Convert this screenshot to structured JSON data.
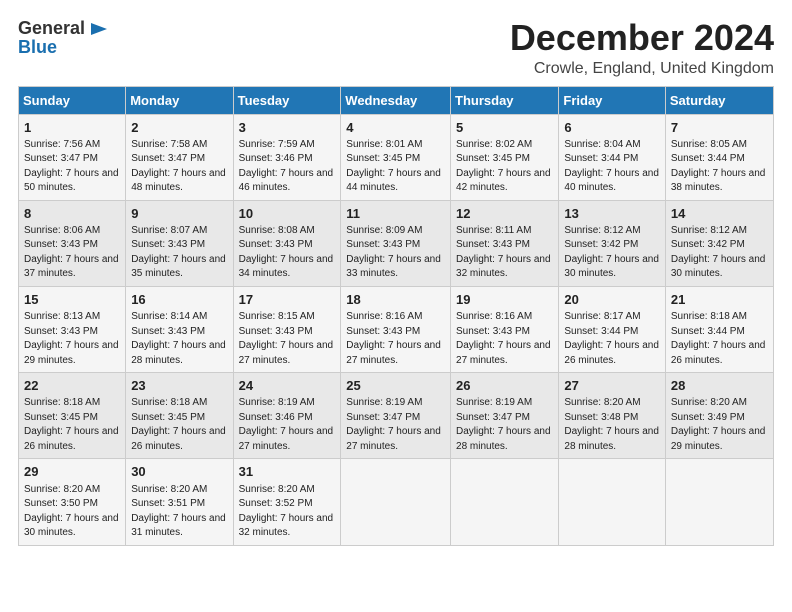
{
  "logo": {
    "line1": "General",
    "line2": "Blue",
    "icon": "▶"
  },
  "title": "December 2024",
  "subtitle": "Crowle, England, United Kingdom",
  "days_header": [
    "Sunday",
    "Monday",
    "Tuesday",
    "Wednesday",
    "Thursday",
    "Friday",
    "Saturday"
  ],
  "weeks": [
    [
      {
        "day": "1",
        "sunrise": "Sunrise: 7:56 AM",
        "sunset": "Sunset: 3:47 PM",
        "daylight": "Daylight: 7 hours and 50 minutes."
      },
      {
        "day": "2",
        "sunrise": "Sunrise: 7:58 AM",
        "sunset": "Sunset: 3:47 PM",
        "daylight": "Daylight: 7 hours and 48 minutes."
      },
      {
        "day": "3",
        "sunrise": "Sunrise: 7:59 AM",
        "sunset": "Sunset: 3:46 PM",
        "daylight": "Daylight: 7 hours and 46 minutes."
      },
      {
        "day": "4",
        "sunrise": "Sunrise: 8:01 AM",
        "sunset": "Sunset: 3:45 PM",
        "daylight": "Daylight: 7 hours and 44 minutes."
      },
      {
        "day": "5",
        "sunrise": "Sunrise: 8:02 AM",
        "sunset": "Sunset: 3:45 PM",
        "daylight": "Daylight: 7 hours and 42 minutes."
      },
      {
        "day": "6",
        "sunrise": "Sunrise: 8:04 AM",
        "sunset": "Sunset: 3:44 PM",
        "daylight": "Daylight: 7 hours and 40 minutes."
      },
      {
        "day": "7",
        "sunrise": "Sunrise: 8:05 AM",
        "sunset": "Sunset: 3:44 PM",
        "daylight": "Daylight: 7 hours and 38 minutes."
      }
    ],
    [
      {
        "day": "8",
        "sunrise": "Sunrise: 8:06 AM",
        "sunset": "Sunset: 3:43 PM",
        "daylight": "Daylight: 7 hours and 37 minutes."
      },
      {
        "day": "9",
        "sunrise": "Sunrise: 8:07 AM",
        "sunset": "Sunset: 3:43 PM",
        "daylight": "Daylight: 7 hours and 35 minutes."
      },
      {
        "day": "10",
        "sunrise": "Sunrise: 8:08 AM",
        "sunset": "Sunset: 3:43 PM",
        "daylight": "Daylight: 7 hours and 34 minutes."
      },
      {
        "day": "11",
        "sunrise": "Sunrise: 8:09 AM",
        "sunset": "Sunset: 3:43 PM",
        "daylight": "Daylight: 7 hours and 33 minutes."
      },
      {
        "day": "12",
        "sunrise": "Sunrise: 8:11 AM",
        "sunset": "Sunset: 3:43 PM",
        "daylight": "Daylight: 7 hours and 32 minutes."
      },
      {
        "day": "13",
        "sunrise": "Sunrise: 8:12 AM",
        "sunset": "Sunset: 3:42 PM",
        "daylight": "Daylight: 7 hours and 30 minutes."
      },
      {
        "day": "14",
        "sunrise": "Sunrise: 8:12 AM",
        "sunset": "Sunset: 3:42 PM",
        "daylight": "Daylight: 7 hours and 30 minutes."
      }
    ],
    [
      {
        "day": "15",
        "sunrise": "Sunrise: 8:13 AM",
        "sunset": "Sunset: 3:43 PM",
        "daylight": "Daylight: 7 hours and 29 minutes."
      },
      {
        "day": "16",
        "sunrise": "Sunrise: 8:14 AM",
        "sunset": "Sunset: 3:43 PM",
        "daylight": "Daylight: 7 hours and 28 minutes."
      },
      {
        "day": "17",
        "sunrise": "Sunrise: 8:15 AM",
        "sunset": "Sunset: 3:43 PM",
        "daylight": "Daylight: 7 hours and 27 minutes."
      },
      {
        "day": "18",
        "sunrise": "Sunrise: 8:16 AM",
        "sunset": "Sunset: 3:43 PM",
        "daylight": "Daylight: 7 hours and 27 minutes."
      },
      {
        "day": "19",
        "sunrise": "Sunrise: 8:16 AM",
        "sunset": "Sunset: 3:43 PM",
        "daylight": "Daylight: 7 hours and 27 minutes."
      },
      {
        "day": "20",
        "sunrise": "Sunrise: 8:17 AM",
        "sunset": "Sunset: 3:44 PM",
        "daylight": "Daylight: 7 hours and 26 minutes."
      },
      {
        "day": "21",
        "sunrise": "Sunrise: 8:18 AM",
        "sunset": "Sunset: 3:44 PM",
        "daylight": "Daylight: 7 hours and 26 minutes."
      }
    ],
    [
      {
        "day": "22",
        "sunrise": "Sunrise: 8:18 AM",
        "sunset": "Sunset: 3:45 PM",
        "daylight": "Daylight: 7 hours and 26 minutes."
      },
      {
        "day": "23",
        "sunrise": "Sunrise: 8:18 AM",
        "sunset": "Sunset: 3:45 PM",
        "daylight": "Daylight: 7 hours and 26 minutes."
      },
      {
        "day": "24",
        "sunrise": "Sunrise: 8:19 AM",
        "sunset": "Sunset: 3:46 PM",
        "daylight": "Daylight: 7 hours and 27 minutes."
      },
      {
        "day": "25",
        "sunrise": "Sunrise: 8:19 AM",
        "sunset": "Sunset: 3:47 PM",
        "daylight": "Daylight: 7 hours and 27 minutes."
      },
      {
        "day": "26",
        "sunrise": "Sunrise: 8:19 AM",
        "sunset": "Sunset: 3:47 PM",
        "daylight": "Daylight: 7 hours and 28 minutes."
      },
      {
        "day": "27",
        "sunrise": "Sunrise: 8:20 AM",
        "sunset": "Sunset: 3:48 PM",
        "daylight": "Daylight: 7 hours and 28 minutes."
      },
      {
        "day": "28",
        "sunrise": "Sunrise: 8:20 AM",
        "sunset": "Sunset: 3:49 PM",
        "daylight": "Daylight: 7 hours and 29 minutes."
      }
    ],
    [
      {
        "day": "29",
        "sunrise": "Sunrise: 8:20 AM",
        "sunset": "Sunset: 3:50 PM",
        "daylight": "Daylight: 7 hours and 30 minutes."
      },
      {
        "day": "30",
        "sunrise": "Sunrise: 8:20 AM",
        "sunset": "Sunset: 3:51 PM",
        "daylight": "Daylight: 7 hours and 31 minutes."
      },
      {
        "day": "31",
        "sunrise": "Sunrise: 8:20 AM",
        "sunset": "Sunset: 3:52 PM",
        "daylight": "Daylight: 7 hours and 32 minutes."
      },
      null,
      null,
      null,
      null
    ]
  ]
}
